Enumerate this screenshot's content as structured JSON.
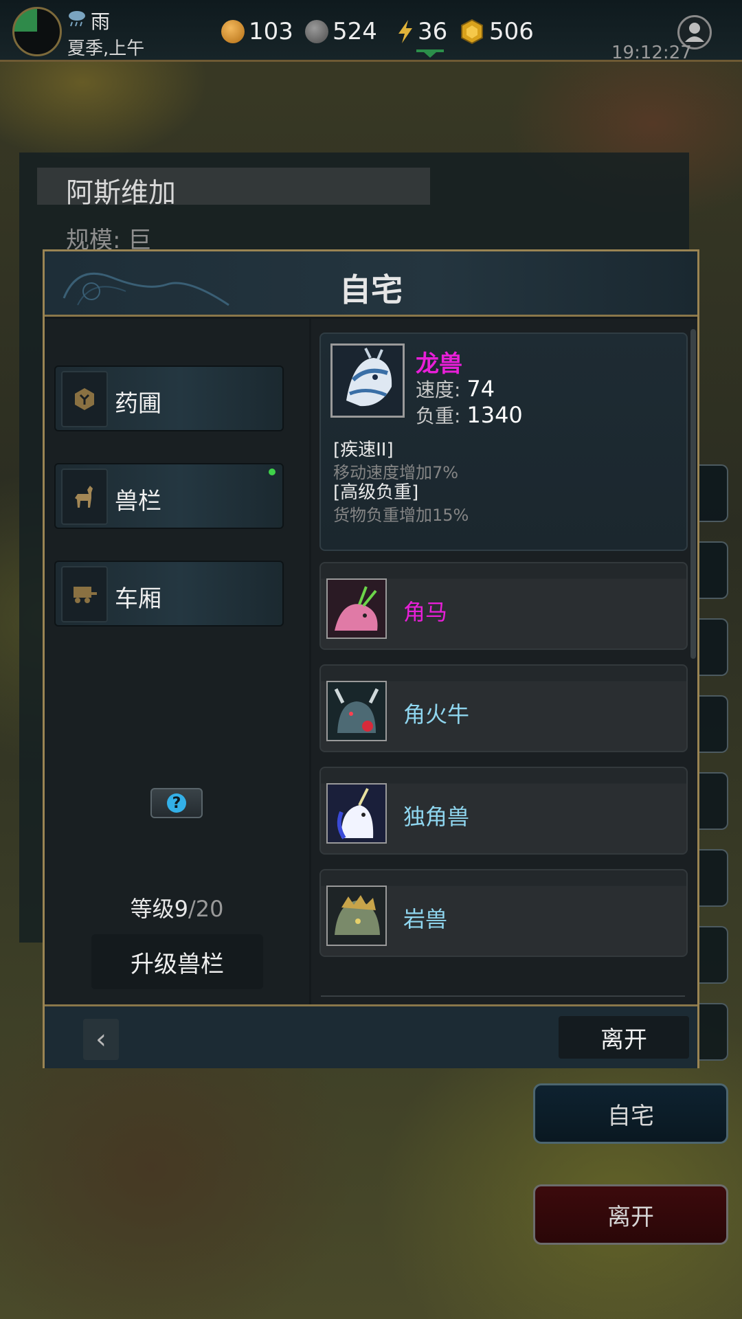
{
  "hud": {
    "weather": "雨",
    "season": "夏季,上午",
    "gold": "103",
    "silver": "524",
    "energy": "36",
    "gems": "506",
    "time": "19:12:27"
  },
  "city": {
    "name": "阿斯维加",
    "size": "规模: 巨"
  },
  "modal": {
    "title": "自宅",
    "categories": [
      {
        "label": "药圃",
        "icon": "herb-icon"
      },
      {
        "label": "兽栏",
        "icon": "horse-icon"
      },
      {
        "label": "车厢",
        "icon": "cart-icon"
      }
    ],
    "level_current": "等级9",
    "level_max": "/20",
    "upgrade_label": "升级兽栏",
    "help_icon": "?",
    "selected_pet": {
      "name": "龙兽",
      "speed_label": "速度:",
      "speed": "74",
      "load_label": "负重:",
      "load": "1340",
      "skills": [
        {
          "name": "[疾速II]",
          "desc": "移动速度增加7%"
        },
        {
          "name": "[高级负重]",
          "desc": "货物负重增加15%"
        }
      ]
    },
    "pets": [
      {
        "name": "角马",
        "color": "#e81fd8"
      },
      {
        "name": "角火牛",
        "color": "#8fd6ef"
      },
      {
        "name": "独角兽",
        "color": "#8fd6ef"
      },
      {
        "name": "岩兽",
        "color": "#8fd6ef"
      }
    ],
    "back_icon": "‹",
    "leave_label": "离开"
  },
  "side": {
    "home_label": "自宅",
    "leave_label": "离开"
  },
  "colors": {
    "rare_pet": "#e81fd8",
    "common_pet": "#8fd6ef",
    "frame_gold": "#9a8453"
  }
}
